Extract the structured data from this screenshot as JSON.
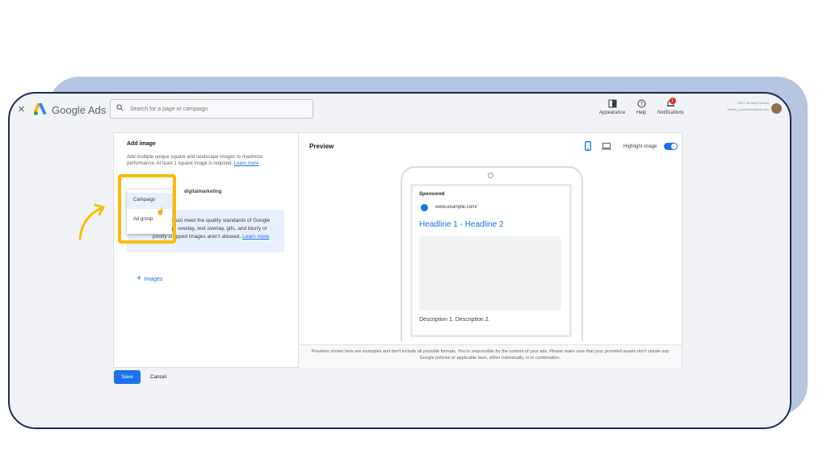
{
  "header": {
    "brand": "Google Ads",
    "search_placeholder": "Search for a page or campaign",
    "appearance_label": "Appearance",
    "help_label": "Help",
    "notifications_label": "Notifications",
    "notifications_count": "1",
    "account_line1": "831-748-6645 Shams",
    "account_line2": "shams_yousef@outlook.com"
  },
  "add_image": {
    "title": "Add image",
    "description": "Add multiple unique square and landscape images to maximize performance. At least 1 square image is required.",
    "learn_more": "Learn more",
    "scope_options": [
      "Campaign",
      "Ad group"
    ],
    "scope_name": "digitalmarketing",
    "info_text": "Images must meet the quality standards of Google Ads. Logo overlay, text overlay, gifs, and blurry or poorly cropped images aren't allowed.",
    "info_learn_more": "Learn more",
    "add_images_label": "Images"
  },
  "preview": {
    "title": "Preview",
    "highlight_label": "Highlight image",
    "highlight_on": true,
    "ad": {
      "sponsored": "Sponsored",
      "url": "www.example.com/",
      "headline": "Headline 1 - Headline 2",
      "description": "Description 1. Description 2."
    },
    "disclaimer": "Previews shown here are examples and don't include all possible formats. You're responsible for the content of your ads. Please make sure that your provided assets don't violate any Google policies or applicable laws, either individually, or in combination."
  },
  "footer": {
    "save_label": "Save",
    "cancel_label": "Cancel"
  },
  "colors": {
    "accent": "#1a73e8",
    "highlight_box": "#fbbc04",
    "frame_border": "#1e2a5a",
    "background_shape": "#b7c6e0"
  }
}
